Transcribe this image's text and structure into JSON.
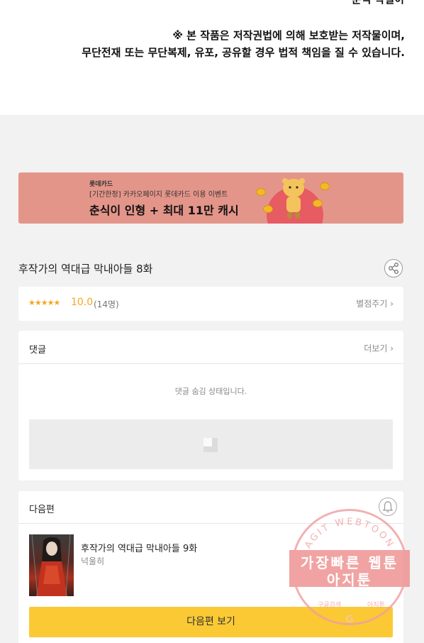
{
  "cut_title": "춘식 작별이",
  "notice": {
    "line1": "※ 본 작품은 저작권법에 의해 보호받는 저작물이며,",
    "line2": "무단전재 또는 무단복제, 유포, 공유할 경우 법적 책임을 질 수 있습니다."
  },
  "banner": {
    "brand": "롯데카드",
    "sub": "[기간한정] 카카오페이지 롯데카드 이용 이벤트",
    "headline": "춘식이 인형 + 최대 11만 캐시"
  },
  "episode": {
    "title": "후작가의 역대급 막내아들 8화"
  },
  "rating": {
    "stars": "★★★★★",
    "score": "10.0",
    "count": "(14명)",
    "link": "별점주기 ›",
    "value": 10.0,
    "max": 10.0
  },
  "comments": {
    "title": "댓글",
    "more": "더보기 ›",
    "hidden_msg": "댓글 숨김 상태입니다."
  },
  "next_episode": {
    "header": "다음편",
    "title": "후작가의 역대급 막내아들 9화",
    "author": "넉울히",
    "button": "다음편 보기"
  },
  "watermark": {
    "arc_top": "AGIT WEBTOON",
    "line1": "가장빠른 웹툰",
    "line2": "아지툰",
    "arc_bottom_left": "구글검색",
    "arc_bottom_right": "아지툰",
    "mark": "G"
  },
  "colors": {
    "accent_yellow": "#fbc934",
    "rating_orange": "#f5a623",
    "banner_bg": "#e4958a",
    "watermark_red": "#ee8f8f"
  },
  "icons": {
    "share": "share-icon",
    "bell": "bell-icon",
    "ad": "ad-placeholder-icon"
  }
}
